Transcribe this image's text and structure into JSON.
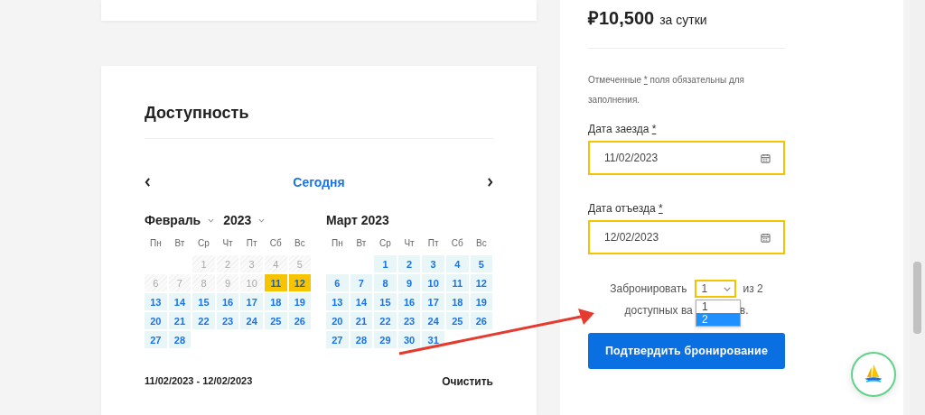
{
  "availability": {
    "title": "Доступность",
    "today": "Сегодня",
    "months": [
      {
        "kind": "selects",
        "month": "Февраль",
        "year": "2023",
        "weekdays": [
          "Пн",
          "Вт",
          "Ср",
          "Чт",
          "Пт",
          "Сб",
          "Вс"
        ],
        "days": [
          {
            "kind": "blank"
          },
          {
            "kind": "blank"
          },
          {
            "label": "1",
            "kind": "past"
          },
          {
            "label": "2",
            "kind": "past"
          },
          {
            "label": "3",
            "kind": "past"
          },
          {
            "label": "4",
            "kind": "past"
          },
          {
            "label": "5",
            "kind": "past"
          },
          {
            "label": "6",
            "kind": "past"
          },
          {
            "label": "7",
            "kind": "past"
          },
          {
            "label": "8",
            "kind": "past"
          },
          {
            "label": "9",
            "kind": "past"
          },
          {
            "label": "10",
            "kind": "past"
          },
          {
            "label": "11",
            "kind": "selected"
          },
          {
            "label": "12",
            "kind": "selected"
          },
          {
            "label": "13",
            "kind": "free"
          },
          {
            "label": "14",
            "kind": "free"
          },
          {
            "label": "15",
            "kind": "free"
          },
          {
            "label": "16",
            "kind": "free"
          },
          {
            "label": "17",
            "kind": "free"
          },
          {
            "label": "18",
            "kind": "free"
          },
          {
            "label": "19",
            "kind": "free"
          },
          {
            "label": "20",
            "kind": "free"
          },
          {
            "label": "21",
            "kind": "free"
          },
          {
            "label": "22",
            "kind": "free"
          },
          {
            "label": "23",
            "kind": "free"
          },
          {
            "label": "24",
            "kind": "free"
          },
          {
            "label": "25",
            "kind": "free"
          },
          {
            "label": "26",
            "kind": "free"
          },
          {
            "label": "27",
            "kind": "free"
          },
          {
            "label": "28",
            "kind": "free"
          }
        ]
      },
      {
        "kind": "title",
        "title": "Март 2023",
        "weekdays": [
          "Пн",
          "Вт",
          "Ср",
          "Чт",
          "Пт",
          "Сб",
          "Вс"
        ],
        "days": [
          {
            "kind": "blank"
          },
          {
            "kind": "blank"
          },
          {
            "label": "1",
            "kind": "free"
          },
          {
            "label": "2",
            "kind": "free"
          },
          {
            "label": "3",
            "kind": "free"
          },
          {
            "label": "4",
            "kind": "free"
          },
          {
            "label": "5",
            "kind": "free"
          },
          {
            "label": "6",
            "kind": "free"
          },
          {
            "label": "7",
            "kind": "free"
          },
          {
            "label": "8",
            "kind": "free"
          },
          {
            "label": "9",
            "kind": "free"
          },
          {
            "label": "10",
            "kind": "free"
          },
          {
            "label": "11",
            "kind": "free"
          },
          {
            "label": "12",
            "kind": "free"
          },
          {
            "label": "13",
            "kind": "free"
          },
          {
            "label": "14",
            "kind": "free"
          },
          {
            "label": "15",
            "kind": "free"
          },
          {
            "label": "16",
            "kind": "free"
          },
          {
            "label": "17",
            "kind": "free"
          },
          {
            "label": "18",
            "kind": "free"
          },
          {
            "label": "19",
            "kind": "free"
          },
          {
            "label": "20",
            "kind": "free"
          },
          {
            "label": "21",
            "kind": "free"
          },
          {
            "label": "22",
            "kind": "free"
          },
          {
            "label": "23",
            "kind": "free"
          },
          {
            "label": "24",
            "kind": "free"
          },
          {
            "label": "25",
            "kind": "free"
          },
          {
            "label": "26",
            "kind": "free"
          },
          {
            "label": "27",
            "kind": "free"
          },
          {
            "label": "28",
            "kind": "free"
          },
          {
            "label": "29",
            "kind": "free"
          },
          {
            "label": "30",
            "kind": "free"
          },
          {
            "label": "31",
            "kind": "free"
          }
        ]
      }
    ],
    "range": "11/02/2023 - 12/02/2023",
    "clear": "Очистить"
  },
  "booking": {
    "price": "₽10,500",
    "per": "за сутки",
    "note": {
      "before": "Отмеченные ",
      "mark": "*",
      "after": " поля обязательны для заполнения."
    },
    "fields": [
      {
        "label": "Дата заезда",
        "mark": "*",
        "value": "11/02/2023"
      },
      {
        "label": "Дата отъезда",
        "mark": "*",
        "value": "12/02/2023"
      }
    ],
    "quantity": {
      "before": "Забронировать",
      "value": "1",
      "after": "из 2",
      "line2_start": "доступных ва",
      "line2_end": "в.",
      "options": [
        {
          "label": "1",
          "highlighted": false
        },
        {
          "label": "2",
          "highlighted": true
        }
      ]
    },
    "submit": "Подтвердить бронирование"
  }
}
